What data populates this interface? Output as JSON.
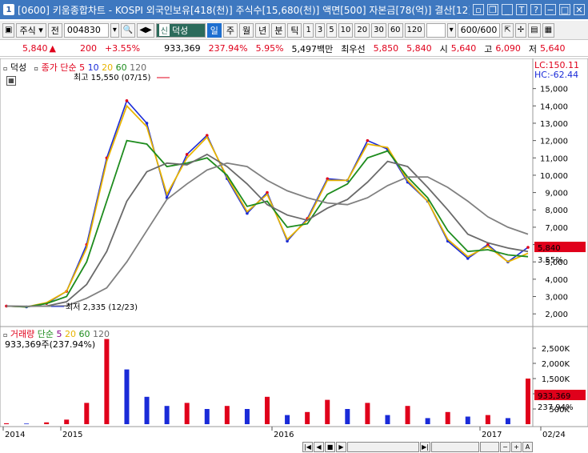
{
  "window": {
    "number": "1",
    "title": "[0600] 키움종합차트 - KOSPI 외국인보유[418(천)] 주식수[15,680(천)] 액면[500] 자본금[78(억)] 결산[12]"
  },
  "toolbar": {
    "market": "주식",
    "jeon": "전",
    "code": "004830",
    "stock_badge": "신",
    "stock_name": "덕성",
    "periods": [
      "일",
      "주",
      "월",
      "년",
      "분",
      "틱"
    ],
    "minutes": [
      "1",
      "3",
      "5",
      "10",
      "20",
      "30",
      "60",
      "120"
    ],
    "count": "600/600"
  },
  "quote": {
    "price": "5,840",
    "change": "200",
    "change_pct": "+3.55%",
    "volume": "933,369",
    "volume_ratio": "237.94%",
    "turnover": "5.95%",
    "amount": "5,497백만",
    "priority_label": "최우선",
    "ask": "5,850",
    "bid": "5,840",
    "open_label": "시",
    "open": "5,640",
    "high_label": "고",
    "high": "6,090",
    "low_label": "저",
    "low": "5,640"
  },
  "price_pane": {
    "legend_name": "덕성",
    "legend_type": "종가 단순",
    "ma": [
      "5",
      "10",
      "20",
      "60",
      "120"
    ],
    "lc": "LC:150.11",
    "hc": "HC:-62.44",
    "max_label": "최고 15,550 (07/15)",
    "min_label": "최저 2,335 (12/23)",
    "last_price_tag": "5,840",
    "last_pct_tag": "3.55%"
  },
  "volume_pane": {
    "legend_name": "거래량",
    "legend_type": "단순",
    "ma": [
      "5",
      "20",
      "60",
      "120"
    ],
    "info": "933,369주(237.94%)",
    "last_tag": "933,369",
    "last_pct_tag": "237.94%"
  },
  "colors": {
    "ma5": "#e8b400",
    "ma10": "#1e8c1e",
    "ma20": "#6a6a6a",
    "ma60": "#1e8c1e",
    "ma120": "#808080",
    "up": "#e0001b",
    "down": "#1a2bd8",
    "titlebar": "#3e78c0"
  },
  "chart_data": [
    {
      "type": "line",
      "title": "덕성 종가 단순",
      "x": [
        "2014-12",
        "2015-01",
        "2015-02",
        "2015-03",
        "2015-04",
        "2015-05",
        "2015-06",
        "2015-07",
        "2015-08",
        "2015-09",
        "2015-10",
        "2015-11",
        "2015-12",
        "2016-01",
        "2016-02",
        "2016-03",
        "2016-04",
        "2016-05",
        "2016-06",
        "2016-07",
        "2016-08",
        "2016-09",
        "2016-10",
        "2016-11",
        "2016-12",
        "2017-01",
        "2017-02"
      ],
      "series": [
        {
          "name": "종가",
          "values": [
            2450,
            2400,
            2600,
            3300,
            6000,
            11000,
            14300,
            13000,
            8700,
            11200,
            12300,
            9800,
            7800,
            9000,
            6200,
            7500,
            9800,
            9700,
            12000,
            11500,
            9600,
            8500,
            6200,
            5200,
            6000,
            5000,
            5840
          ]
        },
        {
          "name": "5",
          "values": [
            2450,
            2400,
            2650,
            3300,
            5800,
            10800,
            14000,
            12800,
            8900,
            11000,
            12200,
            9900,
            7900,
            8900,
            6300,
            7400,
            9700,
            9700,
            11800,
            11600,
            9700,
            8500,
            6300,
            5300,
            5900,
            5000,
            5500
          ]
        },
        {
          "name": "20",
          "values": [
            2450,
            2400,
            2600,
            3000,
            5000,
            8500,
            12000,
            11800,
            10500,
            10700,
            11000,
            10000,
            8200,
            8500,
            7000,
            7200,
            8900,
            9500,
            11000,
            11400,
            9900,
            8700,
            6800,
            5600,
            5700,
            5400,
            5300
          ]
        },
        {
          "name": "60",
          "values": [
            2450,
            2430,
            2450,
            2700,
            3700,
            5600,
            8500,
            10200,
            10700,
            10600,
            11200,
            10500,
            9500,
            8300,
            7700,
            7400,
            8100,
            8600,
            9600,
            10800,
            10500,
            9300,
            8000,
            6600,
            6100,
            5800,
            5600
          ]
        },
        {
          "name": "120",
          "values": [
            2450,
            2440,
            2440,
            2460,
            2900,
            3500,
            5000,
            6800,
            8600,
            9500,
            10300,
            10700,
            10500,
            9700,
            9100,
            8700,
            8400,
            8300,
            8700,
            9400,
            9900,
            9900,
            9300,
            8500,
            7600,
            7000,
            6600
          ]
        }
      ],
      "ylim": [
        1500,
        16000
      ],
      "y_ticks": [
        2000,
        3000,
        4000,
        5000,
        6000,
        7000,
        8000,
        9000,
        10000,
        11000,
        12000,
        13000,
        14000,
        15000
      ],
      "x_ticks": [
        "2014",
        "2015",
        "2016",
        "2017",
        "02/24"
      ],
      "annotations": [
        "최고 15,550 (07/15)",
        "최저 2,335 (12/23)"
      ]
    },
    {
      "type": "bar",
      "title": "거래량 단순",
      "categories": [
        "2014-12",
        "2015-01",
        "2015-02",
        "2015-03",
        "2015-04",
        "2015-05",
        "2015-06",
        "2015-07",
        "2015-08",
        "2015-09",
        "2015-10",
        "2015-11",
        "2015-12",
        "2016-01",
        "2016-02",
        "2016-03",
        "2016-04",
        "2016-05",
        "2016-06",
        "2016-07",
        "2016-08",
        "2016-09",
        "2016-10",
        "2016-11",
        "2016-12",
        "2017-01",
        "2017-02"
      ],
      "values": [
        30000,
        20000,
        60000,
        150000,
        700000,
        2800000,
        1800000,
        900000,
        600000,
        700000,
        500000,
        600000,
        500000,
        900000,
        300000,
        400000,
        800000,
        500000,
        700000,
        300000,
        600000,
        200000,
        400000,
        250000,
        300000,
        200000,
        1500000
      ],
      "ylim": [
        0,
        3000000
      ],
      "y_ticks": [
        500000,
        1000000,
        1500000,
        2000000,
        2500000
      ],
      "y_tick_labels": [
        "500K",
        "1,000K",
        "1,500K",
        "2,000K",
        "2,500K"
      ]
    }
  ]
}
